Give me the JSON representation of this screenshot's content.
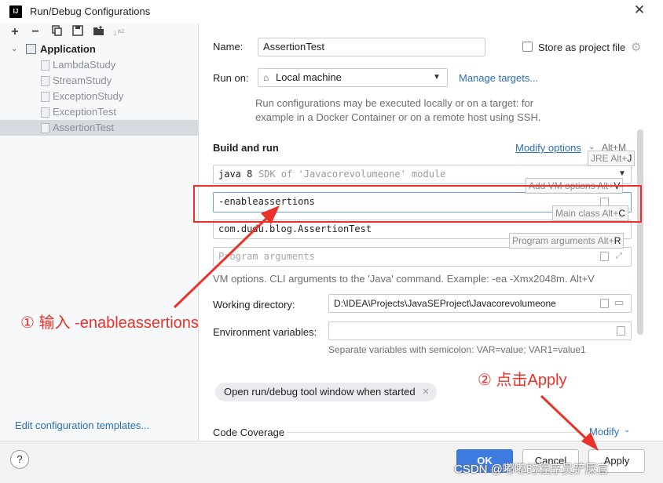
{
  "window": {
    "logo_text": "IJ",
    "title": "Run/Debug Configurations",
    "close_glyph": "✕"
  },
  "tree": {
    "root": "Application",
    "items": [
      "LambdaStudy",
      "StreamStudy",
      "ExceptionStudy",
      "ExceptionTest",
      "AssertionTest"
    ],
    "selected": "AssertionTest"
  },
  "left": {
    "edit_templates": "Edit configuration templates..."
  },
  "form": {
    "name_label": "Name:",
    "name_value": "AssertionTest",
    "store_label": "Store as project file",
    "run_on_label": "Run on:",
    "run_on_value": "Local machine",
    "manage_targets": "Manage targets...",
    "run_on_hint_1": "Run configurations may be executed locally or on a target: for",
    "run_on_hint_2": "example in a Docker Container or on a remote host using SSH.",
    "build_run_title": "Build and run",
    "modify_options": "Modify options",
    "modify_options_shortcut": "Alt+M",
    "sdk_value": "java 8",
    "sdk_hint": "SDK of 'Javacorevolumeone' module",
    "vm_options_value": "-enableassertions",
    "main_class_value": "com.dudu.blog.AssertionTest",
    "program_args_placeholder": "Program arguments",
    "vm_hint": "VM options. CLI arguments to the 'Java' command. Example: -ea -Xmx2048m. Alt+V",
    "workdir_label": "Working directory:",
    "workdir_value": "D:\\IDEA\\Projects\\JavaSEProject\\Javacorevolumeone",
    "env_label": "Environment variables:",
    "env_hint": "Separate variables with semicolon: VAR=value; VAR1=value1",
    "chip_label": "Open run/debug tool window when started",
    "code_coverage": "Code Coverage",
    "modify_link": "Modify"
  },
  "tips": {
    "jre": "JRE Alt+",
    "jre_key": "J",
    "vm": "Add VM options Alt+",
    "vm_key": "V",
    "main": "Main class Alt+",
    "main_key": "C",
    "prog": "Program arguments Alt+",
    "prog_key": "R"
  },
  "buttons": {
    "help": "?",
    "ok": "OK",
    "cancel": "Cancel",
    "apply": "Apply"
  },
  "annotations": {
    "step1": "① 输入 -enableassertions",
    "step2": "② 点击Apply",
    "watermark": "CSDN @嘟嘟的程序员铲屎官",
    "color": "#e8322a"
  }
}
